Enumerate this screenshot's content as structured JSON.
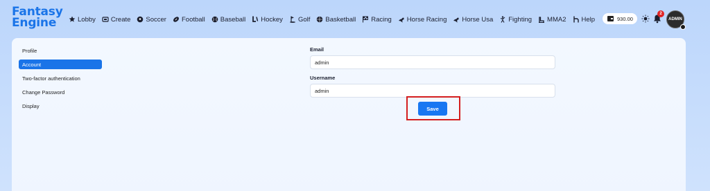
{
  "app": {
    "logo_line1": "Fantasy",
    "logo_line2": "Engine"
  },
  "nav": {
    "items": [
      {
        "label": "Lobby",
        "icon": "star-icon"
      },
      {
        "label": "Create",
        "icon": "create-icon"
      },
      {
        "label": "Soccer",
        "icon": "soccer-ball-icon"
      },
      {
        "label": "Football",
        "icon": "football-icon"
      },
      {
        "label": "Baseball",
        "icon": "baseball-icon"
      },
      {
        "label": "Hockey",
        "icon": "hockey-stick-icon"
      },
      {
        "label": "Golf",
        "icon": "golf-icon"
      },
      {
        "label": "Basketball",
        "icon": "basketball-icon"
      },
      {
        "label": "Racing",
        "icon": "racing-flag-icon"
      },
      {
        "label": "Horse Racing",
        "icon": "horse-icon"
      },
      {
        "label": "Horse Usa",
        "icon": "horse-icon"
      },
      {
        "label": "Fighting",
        "icon": "fighting-icon"
      },
      {
        "label": "MMA2",
        "icon": "mma-icon"
      },
      {
        "label": "Help",
        "icon": "help-icon"
      }
    ]
  },
  "header": {
    "balance": "930.00",
    "notification_count": "2",
    "avatar_text": "ADMIN"
  },
  "sidebar": {
    "items": [
      {
        "label": "Profile",
        "active": false
      },
      {
        "label": "Account",
        "active": true
      },
      {
        "label": "Two-factor authentication",
        "active": false
      },
      {
        "label": "Change Password",
        "active": false
      },
      {
        "label": "Display",
        "active": false
      }
    ]
  },
  "form": {
    "email_label": "Email",
    "email_value": "admin",
    "username_label": "Username",
    "username_value": "admin",
    "save_label": "Save"
  },
  "colors": {
    "accent": "#1877f2",
    "highlight": "#d41e1e",
    "badge": "#e02424"
  }
}
